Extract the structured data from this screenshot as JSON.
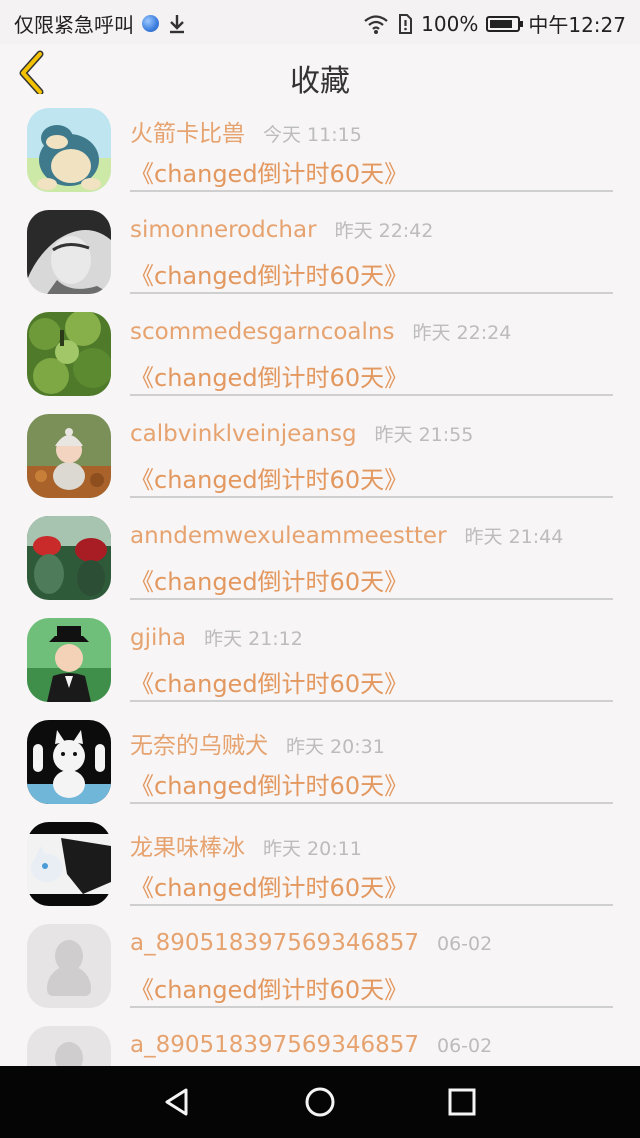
{
  "status_bar": {
    "left_text": "仅限紧急呼叫",
    "battery": "100%",
    "time": "中午12:27",
    "globe_icon": "globe-icon",
    "download_icon": "download-icon",
    "wifi_icon": "wifi-icon",
    "sim_icon": "sim-icon",
    "battery_level": 0.85
  },
  "header": {
    "title": "收藏",
    "back_icon": "chevron-left-icon",
    "accent_color": "#f2c200"
  },
  "list": {
    "name_color": "#e6a36f",
    "message_color": "#e3985f",
    "items": [
      {
        "name": "火箭卡比兽",
        "time": "今天 11:15",
        "message": "《changed倒计时60天》",
        "avatar": "snorlax-avatar"
      },
      {
        "name": "simonnerodchar",
        "time": "昨天 22:42",
        "message": "《changed倒计时60天》",
        "avatar": "bw-portrait-avatar"
      },
      {
        "name": "scommedesgarncoalns",
        "time": "昨天 22:24",
        "message": "《changed倒计时60天》",
        "avatar": "green-leaves-avatar"
      },
      {
        "name": "calbvinklveinjeansg",
        "time": "昨天 21:55",
        "message": "《changed倒计时60天》",
        "avatar": "baby-autumn-avatar"
      },
      {
        "name": "anndemwexuleammeestter",
        "time": "昨天 21:44",
        "message": "《changed倒计时60天》",
        "avatar": "red-cactus-avatar"
      },
      {
        "name": "gjiha",
        "time": "昨天 21:12",
        "message": "《changed倒计时60天》",
        "avatar": "child-hat-avatar"
      },
      {
        "name": "无奈的乌贼犬",
        "time": "昨天 20:31",
        "message": "《changed倒计时60天》",
        "avatar": "cartoon-cat-avatar"
      },
      {
        "name": "龙果味棒冰",
        "time": "昨天 20:11",
        "message": "《changed倒计时60天》",
        "avatar": "anime-wolf-avatar"
      },
      {
        "name": "a_890518397569346857",
        "time": "06-02",
        "message": "《changed倒计时60天》",
        "avatar": "default-avatar"
      },
      {
        "name": "a_890518397569346857",
        "time": "06-02",
        "message": "",
        "avatar": "default-avatar"
      }
    ]
  },
  "nav_bar": {
    "back_icon": "nav-back-icon",
    "home_icon": "nav-home-icon",
    "recents_icon": "nav-recents-icon"
  }
}
